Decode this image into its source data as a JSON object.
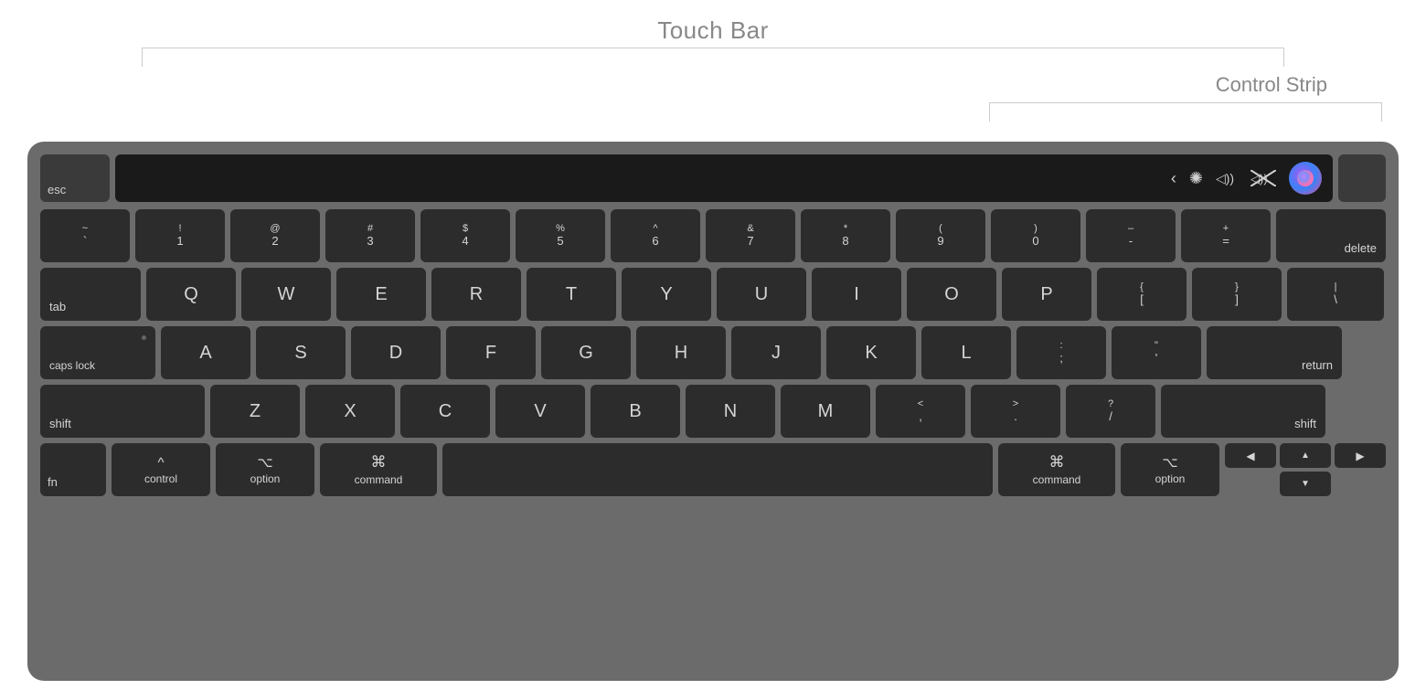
{
  "annotations": {
    "touch_bar_label": "Touch Bar",
    "control_strip_label": "Control Strip"
  },
  "keyboard": {
    "touch_bar_row": {
      "esc": "esc",
      "power_key": ""
    },
    "touch_bar_icons": {
      "chevron": "‹",
      "brightness": "✺",
      "volume": "◁)))",
      "mute": "◁)x",
      "siri": "siri"
    },
    "row1": {
      "keys": [
        {
          "top": "~",
          "bot": "`"
        },
        {
          "top": "!",
          "bot": "1"
        },
        {
          "top": "@",
          "bot": "2"
        },
        {
          "top": "#",
          "bot": "3"
        },
        {
          "top": "$",
          "bot": "4"
        },
        {
          "top": "%",
          "bot": "5"
        },
        {
          "top": "^",
          "bot": "6"
        },
        {
          "top": "&",
          "bot": "7"
        },
        {
          "top": "*",
          "bot": "8"
        },
        {
          "top": "(",
          "bot": "9"
        },
        {
          "top": ")",
          "bot": "0"
        },
        {
          "top": "–",
          "bot": "-"
        },
        {
          "top": "+",
          "bot": "="
        },
        {
          "label": "delete"
        }
      ]
    },
    "row2": {
      "tab": "tab",
      "keys": [
        "Q",
        "W",
        "E",
        "R",
        "T",
        "Y",
        "U",
        "I",
        "O",
        "P"
      ],
      "brace_open": {
        "top": "{",
        "bot": "["
      },
      "brace_close": {
        "top": "}",
        "bot": "]"
      },
      "backslash": {
        "top": "|",
        "bot": "\\"
      }
    },
    "row3": {
      "caps": "caps lock",
      "keys": [
        "A",
        "S",
        "D",
        "F",
        "G",
        "H",
        "J",
        "K",
        "L"
      ],
      "semi": {
        "top": ":",
        "bot": ";"
      },
      "quote": {
        "top": "\"",
        "bot": "'"
      },
      "return": "return"
    },
    "row4": {
      "shift_l": "shift",
      "keys": [
        "Z",
        "X",
        "C",
        "V",
        "B",
        "N",
        "M"
      ],
      "comma": {
        "top": "<",
        "bot": ","
      },
      "period": {
        "top": ">",
        "bot": "."
      },
      "slash": {
        "top": "?",
        "bot": "/"
      },
      "shift_r": "shift"
    },
    "row5": {
      "fn": "fn",
      "ctrl_icon": "^",
      "ctrl": "control",
      "opt_l_icon": "⌥",
      "opt_l": "option",
      "cmd_l_icon": "⌘",
      "cmd_l": "command",
      "cmd_r_icon": "⌘",
      "cmd_r": "command",
      "opt_r_icon": "⌥",
      "opt_r": "option"
    },
    "arrows": {
      "up": "▲",
      "left": "◀",
      "down": "▼",
      "right": "▶"
    }
  }
}
